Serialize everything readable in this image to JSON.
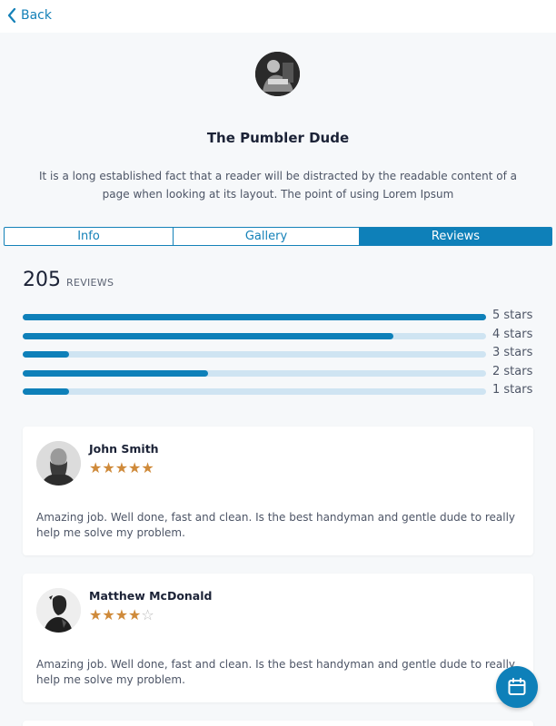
{
  "nav": {
    "back_label": "Back"
  },
  "profile": {
    "name": "The Pumbler Dude",
    "description": "It is a long established fact that a reader will be distracted by the readable content of a page when looking at its layout. The point of using Lorem Ipsum"
  },
  "tabs": [
    {
      "label": "Info",
      "active": false
    },
    {
      "label": "Gallery",
      "active": false
    },
    {
      "label": "Reviews",
      "active": true
    }
  ],
  "reviews_summary": {
    "count": "205",
    "count_label": "REVIEWS",
    "breakdown": [
      {
        "label": "5 stars",
        "fraction": 1.0
      },
      {
        "label": "4 stars",
        "fraction": 0.8
      },
      {
        "label": "3 stars",
        "fraction": 0.1
      },
      {
        "label": "2 stars",
        "fraction": 0.4
      },
      {
        "label": "1 stars",
        "fraction": 0.1
      }
    ]
  },
  "reviews": [
    {
      "name": "John Smith",
      "rating": 5,
      "text": "Amazing job. Well done, fast and clean. Is the best handyman and gentle dude to really help me solve my problem."
    },
    {
      "name": "Matthew McDonald",
      "rating": 4,
      "text": "Amazing job. Well done, fast and clean. Is the best handyman and gentle dude to really help me solve my problem."
    }
  ],
  "colors": {
    "accent": "#0e80b9",
    "bar_track": "#cfe4f2",
    "star": "#cf8a3a"
  },
  "icons": {
    "back": "chevron-left-icon",
    "fab": "calendar-icon"
  }
}
